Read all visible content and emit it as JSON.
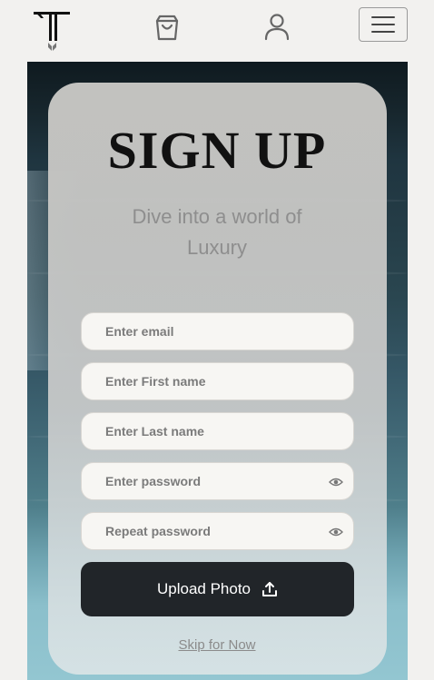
{
  "nav": {
    "logo_icon": "tt-monogram-logo",
    "cart_icon": "shopping-bag-icon",
    "user_icon": "user-icon",
    "menu_icon": "hamburger-menu-icon"
  },
  "signup": {
    "title": "SIGN UP",
    "subtitle": "Dive into a world of Luxury",
    "fields": {
      "email": {
        "placeholder": "Enter email",
        "value": ""
      },
      "first_name": {
        "placeholder": "Enter First name",
        "value": ""
      },
      "last_name": {
        "placeholder": "Enter Last name",
        "value": ""
      },
      "password": {
        "placeholder": "Enter password",
        "value": "",
        "icon": "eye-icon"
      },
      "repeat_password": {
        "placeholder": "Repeat password",
        "value": "",
        "icon": "eye-icon"
      }
    },
    "upload_label": "Upload Photo",
    "upload_icon": "upload-icon",
    "skip_label": "Skip for Now"
  },
  "colors": {
    "page_background": "#f2f1ef",
    "button_dark": "#212529",
    "input_background": "#f7f6f3",
    "title_text": "#111111",
    "muted_text": "#8e8e8e"
  }
}
